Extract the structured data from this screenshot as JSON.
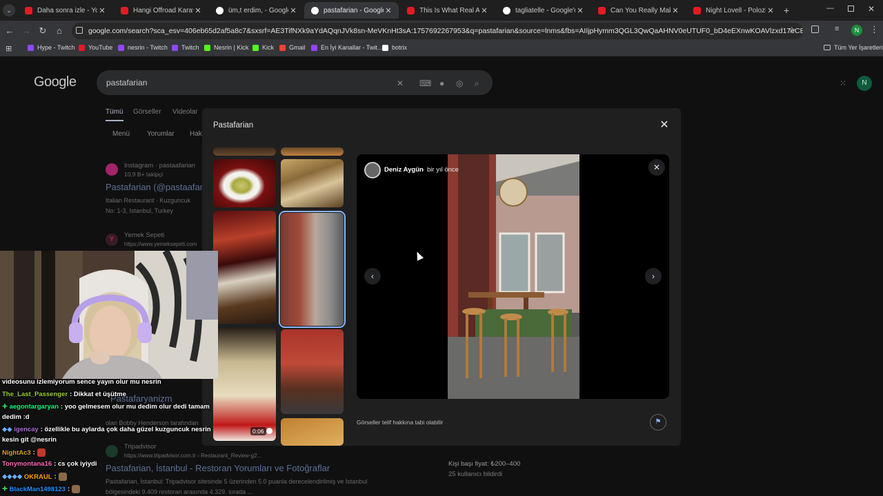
{
  "tabs": [
    {
      "title": "Daha sonra izle - YouTube",
      "favicon": "youtube-icon"
    },
    {
      "title": "Hangi Offroad Karavan D",
      "favicon": "youtube-icon"
    },
    {
      "title": "üm,t erdim, - Google'da A",
      "favicon": "google-icon"
    },
    {
      "title": "pastafarian - Google'da A",
      "favicon": "google-icon",
      "active": true
    },
    {
      "title": "This Is What Real Arrabbi",
      "favicon": "youtube-icon"
    },
    {
      "title": "tagliatelle - Google'da Ar",
      "favicon": "google-icon"
    },
    {
      "title": "Can You Really Make Perf",
      "favicon": "youtube-icon"
    },
    {
      "title": "Night Lovell - Polozhenie",
      "favicon": "youtube-icon"
    }
  ],
  "address": {
    "url": "google.com/search?sca_esv=406eb65d2af5a8c7&sxsrf=AE3TifNXk9aYdAQqnJVk8sn-MeVKnHt3sA:1757692267953&q=pastafarian&source=lnms&fbs=AIIjpHymm3QGL3QwQaAHNV0eUTUF0_bD4eEXnwKOAVlzxd17eCER2x-6pKKY7j2Sz2VZ0wy..."
  },
  "bookmarks": [
    {
      "label": "Hype - Twitch",
      "color": "#9146ff"
    },
    {
      "label": "YouTube",
      "color": "#e31b23"
    },
    {
      "label": "nesrin - Twitch",
      "color": "#9146ff"
    },
    {
      "label": "Twitch",
      "color": "#9146ff"
    },
    {
      "label": "Nesrin | Kick",
      "color": "#53fc18"
    },
    {
      "label": "Kick",
      "color": "#53fc18"
    },
    {
      "label": "Gmail",
      "color": "#ea4335"
    },
    {
      "label": "En İyi Kanallar - Twit...",
      "color": "#9146ff"
    },
    {
      "label": "botrix",
      "color": "#ffffff"
    }
  ],
  "all_bookmarks_label": "Tüm Yer İşaretleri",
  "profile_initial": "N",
  "google": {
    "logo": "Google",
    "query": "pastafarian",
    "tabs": [
      "Tümü",
      "Görseller",
      "Videolar"
    ],
    "chips": [
      "Menü",
      "Yorumlar",
      "Haki"
    ],
    "results": [
      {
        "source": "Instagram · pastaafarian",
        "sub": "10,9 B+ takipçi",
        "title": "Pastafarian (@pastaafar",
        "snippet1": "Italian Restaurant · Kuzguncuk",
        "snippet2": "No: 1-3, Istanbul, Turkey"
      },
      {
        "source": "Yemek Sepeti",
        "sub": "https://www.yemeksepeti.com"
      },
      {
        "title": "Pastafaryanizm",
        "snippet": "olan Bobby Henderson tarafından"
      },
      {
        "source": "Tripadvisor",
        "sub": "https://www.tripadvisor.com.tr › Restaurant_Review-g2...",
        "title": "Pastafarian, İstanbul - Restoran Yorumları ve Fotoğraflar",
        "snippet1": "Pastafarian, İstanbul: Tripadvisor sitesinde 5 üzerinden 5.0 puanla derecelendirilmiş ve İstanbul",
        "snippet2": "bölgesindeki 9.409 restoran arasında 4.329. sırada ..."
      }
    ],
    "right_panel": {
      "price_label": "Kişi başı fiyat: ₺200–400",
      "price_sub": "25 kullanıcı bildirdi"
    }
  },
  "modal": {
    "title": "Pastafarian",
    "viewer": {
      "author": "Deniz Aygün",
      "time": "bir yıl önce",
      "copyright": "Görseller telif hakkına tabi olabilir"
    },
    "video_duration": "0:06"
  },
  "chat": [
    {
      "user": "",
      "message": "videosunu izlemiyorum sence yayın olur mu nesrin",
      "color": "#ffffff"
    },
    {
      "user": "The_Last_Passenger",
      "message": ": Dikkat et üşütme",
      "color": "#9acd32"
    },
    {
      "user": "aegontargaryan",
      "message": ": yoo gelmesem olur mu dedim olur dedi tamam",
      "color": "#00ff7f"
    },
    {
      "user": "",
      "message": "dedim :d",
      "color": "#ffffff"
    },
    {
      "user": "igencay",
      "message": ": özellikle bu aylarda çok daha güzel kuzguncuk nesrin",
      "color": "#8a2be2"
    },
    {
      "user": "",
      "message": "kesin git @nesrin",
      "color": "#ffffff"
    },
    {
      "user": "NightAc3",
      "message": ":",
      "color": "#daa520"
    },
    {
      "user": "Tonymontana16",
      "message": ": cs çok iyiydi",
      "color": "#ff69b4"
    },
    {
      "user": "OKRAUL",
      "message": ":",
      "color": "#ffa500"
    },
    {
      "user": "BlackMan1498123",
      "message": ":",
      "color": "#1e90ff"
    }
  ]
}
